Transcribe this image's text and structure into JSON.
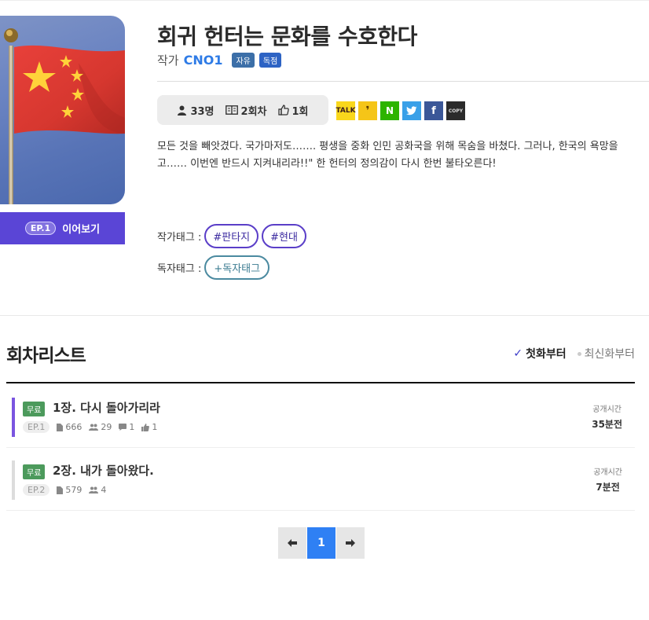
{
  "novel": {
    "title": "회귀 헌터는 문화를 수호한다",
    "author_label": "작가",
    "author": "CNO1",
    "badges": [
      "자유",
      "독점"
    ],
    "continue": {
      "ep": "EP.1",
      "label": "이어보기"
    }
  },
  "stats": {
    "readers": "33명",
    "episodes": "2회차",
    "likes": "1회"
  },
  "share": [
    {
      "name": "kakaotalk-icon",
      "text": "TALK"
    },
    {
      "name": "kakaostory-icon",
      "text": "❜"
    },
    {
      "name": "naver-icon",
      "text": "N"
    },
    {
      "name": "twitter-icon",
      "text": "🐦"
    },
    {
      "name": "facebook-icon",
      "text": "f"
    },
    {
      "name": "copy-link-icon",
      "text": "COPY"
    }
  ],
  "synopsis": [
    "모든 것을 빼앗겼다. 국가마저도……. 평생을 중화 인민 공화국을 위해 목숨을 바쳤다. 그러나, 한국의 욕망을",
    "고…… 이번엔 반드시 지켜내리라!!\" 한 헌터의 정의감이 다시 한번 불타오른다!"
  ],
  "tags": {
    "author_label": "작가태그 :",
    "author_tags": [
      "#판타지",
      "#현대"
    ],
    "reader_label": "독자태그 :",
    "reader_add": "+독자태그"
  },
  "episode_list": {
    "title": "회차리스트",
    "sort_first": "첫화부터",
    "sort_latest": "최신화부터",
    "rows": [
      {
        "free": "무료",
        "title": "1장. 다시 돌아가리라",
        "ep": "EP.1",
        "views": "666",
        "readers": "29",
        "comments": "1",
        "likes": "1",
        "pub_label": "공개시간",
        "pub_time": "35분전"
      },
      {
        "free": "무료",
        "title": "2장. 내가 돌아왔다.",
        "ep": "EP.2",
        "views": "579",
        "readers": "4",
        "pub_label": "공개시간",
        "pub_time": "7분전"
      }
    ]
  },
  "pager": {
    "prev": "🡐",
    "current": "1",
    "next": "🡒"
  },
  "colors": {
    "accent": "#5a45d6",
    "author": "#2e7be6",
    "page_current": "#2f80f4",
    "free_badge": "#4c9a5c"
  }
}
